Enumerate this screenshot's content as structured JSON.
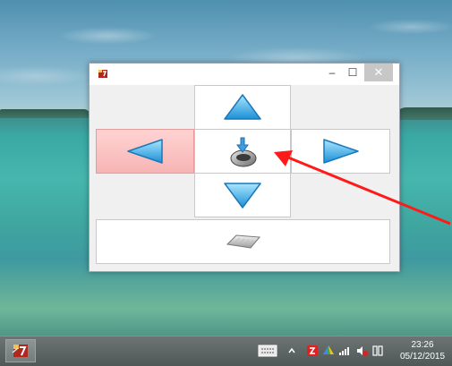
{
  "window": {
    "title_icon": "app-logo-icon",
    "controls": {
      "minimize": "–",
      "maximize": "☐",
      "close": "✕"
    }
  },
  "panel": {
    "up_icon": "arrow-up-icon",
    "left_icon": "arrow-left-icon",
    "center_icon": "mouse-click-icon",
    "right_icon": "arrow-right-icon",
    "down_icon": "arrow-down-icon",
    "keyboard_icon": "keyboard-icon",
    "selected": "left",
    "selected_color": "#f7b4b4"
  },
  "taskbar": {
    "pinned_app_icon": "app-logo-icon",
    "tray_icons": [
      "touch-keyboard-icon",
      "show-hidden-icons-icon",
      "antivirus-icon",
      "network-share-icon",
      "signal-icon",
      "volume-muted-icon",
      "network-icon"
    ],
    "time": "23:26",
    "date": "05/12/2015"
  },
  "colors": {
    "annotation_arrow": "#ff1a1a",
    "taskbar": "#5d6565"
  }
}
